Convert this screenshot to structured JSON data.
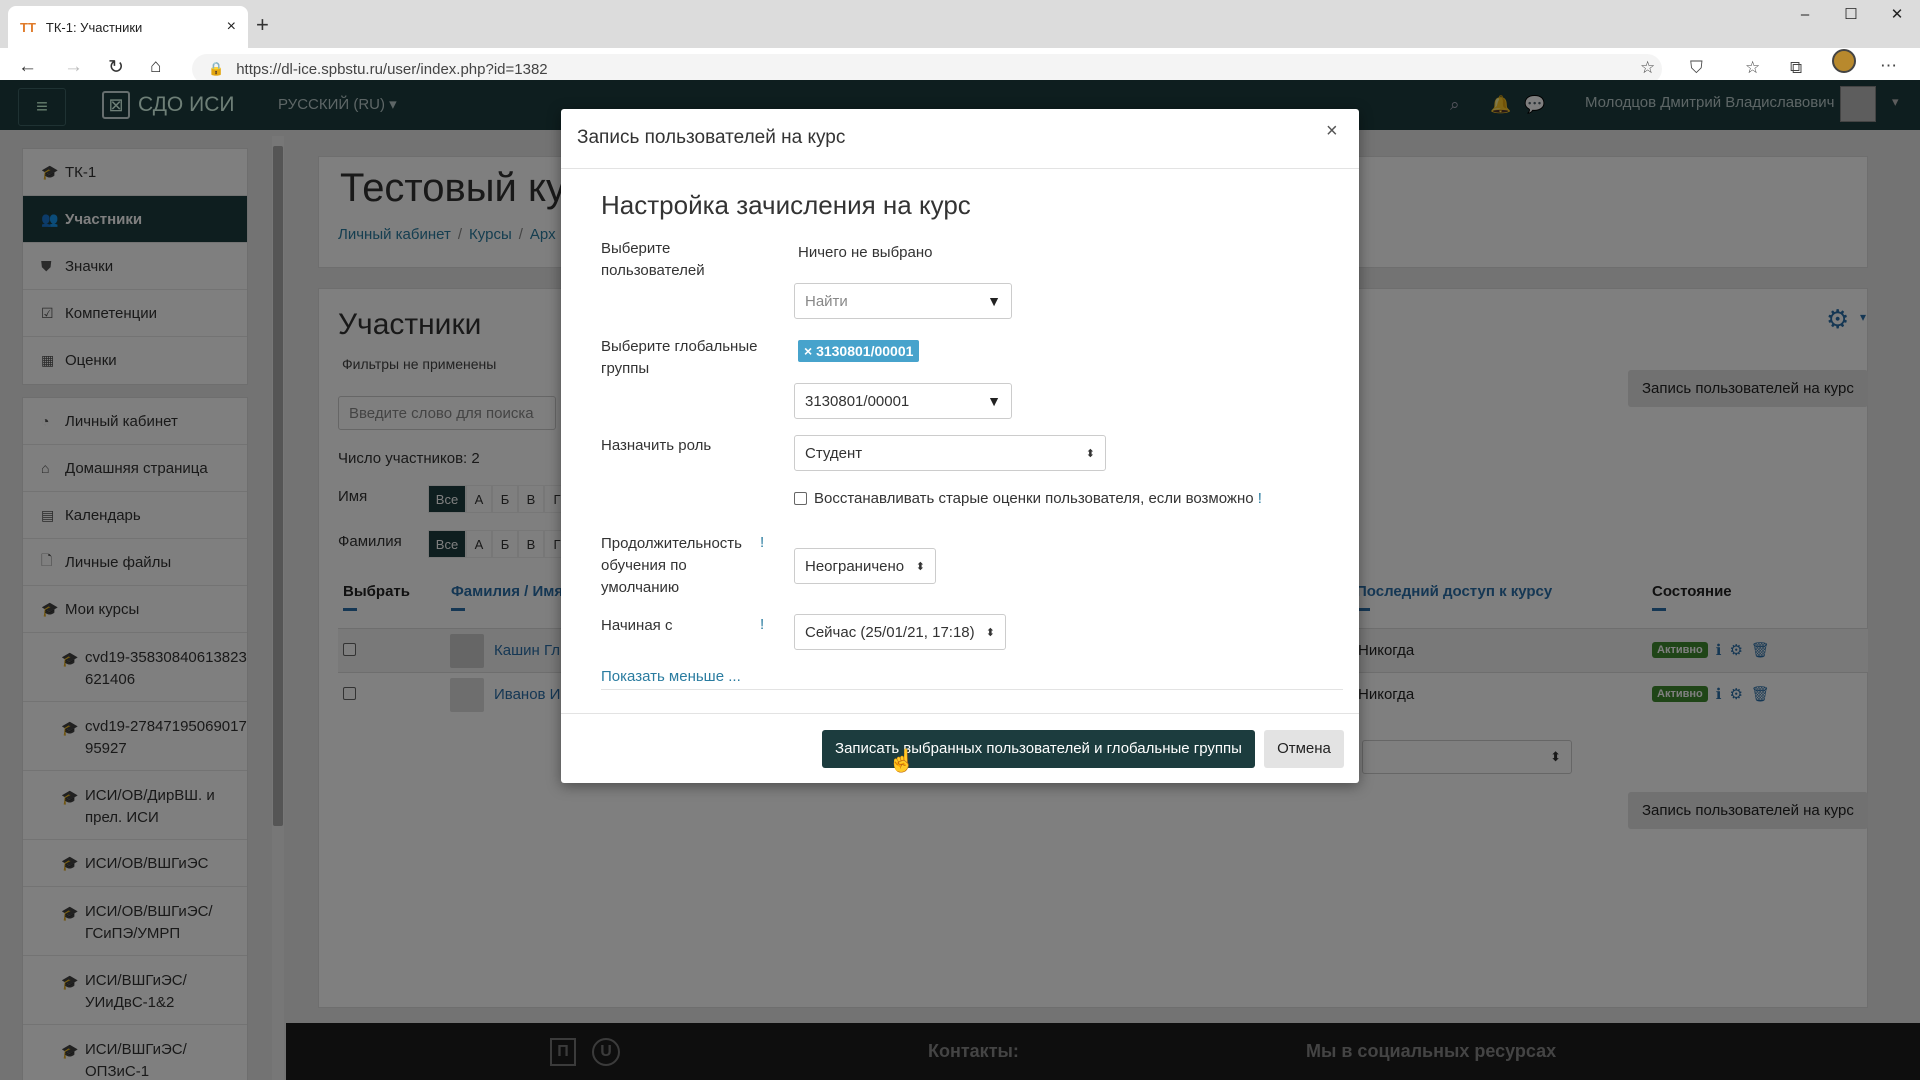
{
  "browser": {
    "tab_title": "ТК-1: Участники",
    "url": "https://dl-ice.spbstu.ru/user/index.php?id=1382"
  },
  "navbar": {
    "logo_text": "СДО ИСИ",
    "language": "РУССКИЙ (RU) ▾",
    "user_name": "Молодцов Дмитрий Владиславович"
  },
  "sidebar": {
    "group1": [
      {
        "label": "ТК-1",
        "icon": "graduation-cap-icon"
      },
      {
        "label": "Участники",
        "icon": "users-icon",
        "active": true
      },
      {
        "label": "Значки",
        "icon": "shield-icon"
      },
      {
        "label": "Компетенции",
        "icon": "check-square-icon"
      },
      {
        "label": "Оценки",
        "icon": "table-icon"
      }
    ],
    "group2": [
      {
        "label": "Личный кабинет",
        "icon": "dashboard-icon"
      },
      {
        "label": "Домашняя страница",
        "icon": "home-icon"
      },
      {
        "label": "Календарь",
        "icon": "calendar-icon"
      },
      {
        "label": "Личные файлы",
        "icon": "file-icon"
      },
      {
        "label": "Мои курсы",
        "icon": "graduation-cap-icon"
      }
    ],
    "courses": [
      "cvd19-35830840613823621406",
      "cvd19-278471950690179592​7",
      "ИСИ/ОВ/ДирВШ. и прел. ИСИ",
      "ИСИ/ОВ/ВШГиЭС",
      "ИСИ/ОВ/ВШГиЭС/ ГСиПЭ/УМРП",
      "ИСИ/ВШГиЭС/ УИиДвС-1&2",
      "ИСИ/ВШГиЭС/ ОПЗиС-1"
    ]
  },
  "course": {
    "title": "Тестовый кур",
    "breadcrumb": [
      "Личный кабинет",
      "Курсы",
      "Арх"
    ]
  },
  "participants": {
    "title": "Участники",
    "filters": "Фильтры не применены",
    "search_placeholder": "Введите слово для поиска",
    "count": "Число участников: 2",
    "first_name_label": "Имя",
    "last_name_label": "Фамилия",
    "letters": [
      "Все",
      "А",
      "Б",
      "В",
      "Г"
    ],
    "enrol_button": "Запись пользователей на курс",
    "columns": {
      "select": "Выбрать",
      "name": "Фамилия / Имя",
      "last_access": "Последний доступ к курсу",
      "status": "Состояние"
    },
    "rows": [
      {
        "name": "Кашин Гл",
        "last_access": "Никогда",
        "status": "Активно"
      },
      {
        "name": "Иванов И",
        "last_access": "Никогда",
        "status": "Активно"
      }
    ]
  },
  "footer": {
    "contacts": "Контакты:",
    "social": "Мы в социальных ресурсах"
  },
  "modal": {
    "title": "Запись пользователей на курс",
    "subtitle": "Настройка зачисления на курс",
    "select_users_label": "Выберите пользователей",
    "nothing_selected": "Ничего не выбрано",
    "find_placeholder": "Найти",
    "select_groups_label": "Выберите глобальные группы",
    "group_tag": "× 3130801/00001",
    "group_value": "3130801/00001",
    "role_label": "Назначить роль",
    "role_value": "Студент",
    "restore_grades": "Восстанавливать старые оценки пользователя, если возможно",
    "duration_label": "Продолжительность обучения по умолчанию",
    "duration_value": "Неограничено",
    "start_label": "Начиная с",
    "start_value": "Сейчас (25/01/21, 17:18)",
    "show_less": "Показать меньше ...",
    "save_button": "Записать выбранных пользователей и глобальные группы",
    "cancel_button": "Отмена"
  }
}
